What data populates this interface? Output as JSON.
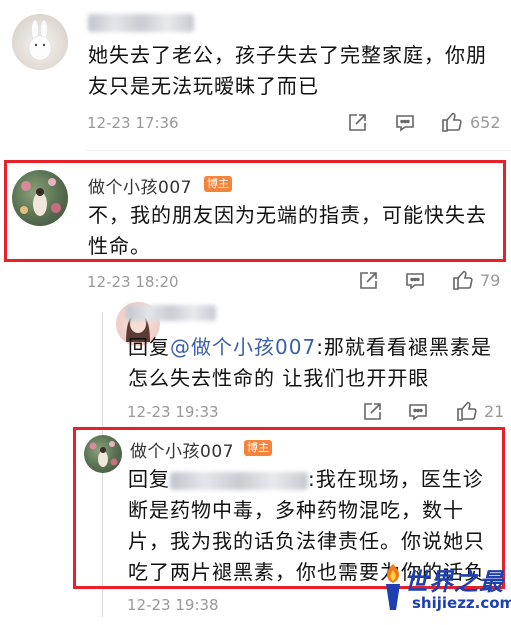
{
  "comments": [
    {
      "username": "",
      "text": "她失去了老公，孩子失去了完整家庭，你朋友只是无法玩暧昧了而已",
      "time": "12-23 17:36",
      "likes": "652"
    },
    {
      "username": "做个小孩007",
      "badge": "博主",
      "text": "不，我的朋友因为无端的指责，可能快失去性命。",
      "time": "12-23 18:20",
      "likes": "79"
    }
  ],
  "replies": [
    {
      "username": "",
      "reply_prefix": "回复",
      "mention": "@做个小孩007",
      "text": ":那就看看褪黑素是怎么失去性命的 让我们也开开眼",
      "time": "12-23 19:33",
      "likes": "21"
    },
    {
      "username": "做个小孩007",
      "badge": "博主",
      "reply_prefix": "回复",
      "text": ":我在现场，医生诊断是药物中毒，多种药物混吃，数十片，我为我的话负法律责任。你说她只吃了两片褪黑素，你也需要为你的话负责。",
      "time": "12-23 19:38"
    }
  ],
  "watermark": {
    "title": "世界之最",
    "url": "shijiezz.com"
  },
  "colors": {
    "highlight_border": "#e8202a",
    "badge": "#f5833a",
    "mention": "#3b5fa8",
    "meta": "#999999"
  }
}
